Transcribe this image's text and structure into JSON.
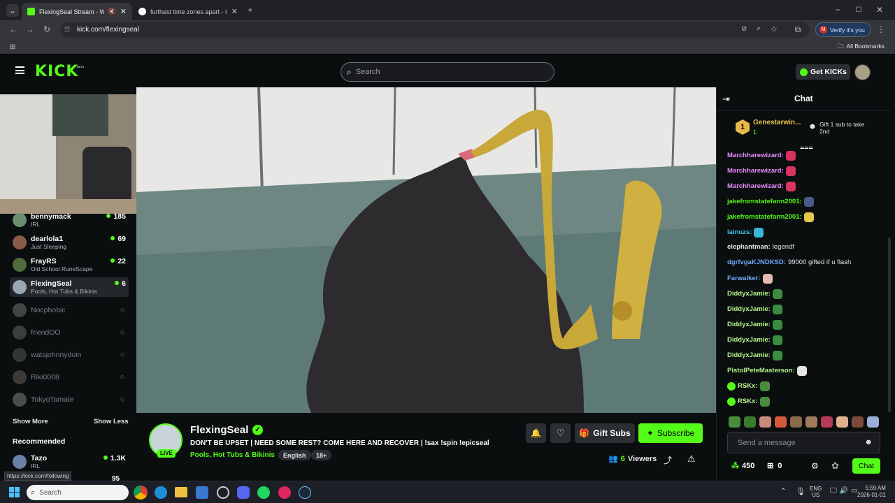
{
  "browser": {
    "tabs": [
      {
        "title": "FlexingSeal Stream - Watch",
        "active": true
      },
      {
        "title": "furthest time zones apart - Goo",
        "active": false
      }
    ],
    "url": "kick.com/flexingseal",
    "profile_label": "Verify it's you",
    "profile_initial": "M",
    "all_bookmarks": "All Bookmarks",
    "status_url": "https://kick.com/following"
  },
  "kick": {
    "logo": "KICK",
    "logo_beta": "BETA",
    "search_placeholder": "Search",
    "get_kicks": "Get KICKs"
  },
  "sidebar": {
    "channels": [
      {
        "name": "bennymack",
        "category": "IRL",
        "viewers": "185",
        "color": "#6b8f71"
      },
      {
        "name": "dearlola1",
        "category": "Just Sleeping",
        "viewers": "69",
        "color": "#8a5a4a"
      },
      {
        "name": "FrayRS",
        "category": "Old School RuneScape",
        "viewers": "22",
        "color": "#4e6b3a"
      },
      {
        "name": "FlexingSeal",
        "category": "Pools, Hot Tubs & Bikinis",
        "viewers": "6",
        "color": "#9aa7b3"
      }
    ],
    "offline": [
      "Nocphobic",
      "friendOO",
      "watsjohnnydoin",
      "Riki0008",
      "TokyoTamale"
    ],
    "show_more": "Show More",
    "show_less": "Show Less",
    "recommended_title": "Recommended",
    "recommended": [
      {
        "name": "Tazo",
        "category": "IRL",
        "viewers": "1.3K",
        "color": "#6a7fa8"
      },
      {
        "name": "",
        "category": "",
        "viewers": "95",
        "color": "#555"
      }
    ]
  },
  "stream": {
    "streamer": "FlexingSeal",
    "live_badge": "LIVE",
    "title": "DON'T BE UPSET | NEED SOME REST? COME HERE AND RECOVER | !sax !spin !epicseal",
    "category": "Pools, Hot Tubs & Bikinis",
    "tags": [
      "English",
      "18+"
    ],
    "viewers_count": "6",
    "viewers_label": "Viewers",
    "gift_subs": "Gift Subs",
    "subscribe": "Subscribe"
  },
  "chat": {
    "title": "Chat",
    "pinned_rank": "1",
    "pinned_user": "Genestarwin...",
    "pinned_count": "1",
    "gift_text": "Gift 1 sub to take 2nd",
    "messages": [
      {
        "user": "Marchharewizard:",
        "text": "",
        "color": "#e58cff",
        "emote": "#d8345f"
      },
      {
        "user": "Marchharewizard:",
        "text": "",
        "color": "#e58cff",
        "emote": "#d8345f"
      },
      {
        "user": "Marchharewizard:",
        "text": "",
        "color": "#e58cff",
        "emote": "#d8345f"
      },
      {
        "user": "jakefromstatefarm2001:",
        "text": "",
        "color": "#53fc18",
        "emote": "#4a5a8a"
      },
      {
        "user": "jakefromstatefarm2001:",
        "text": "",
        "color": "#53fc18",
        "emote": "#e5c84b"
      },
      {
        "user": "lainuzs:",
        "text": "",
        "color": "#37c7e8",
        "emote": "#3bb6d8"
      },
      {
        "user": "elephantman:",
        "text": "legendf",
        "color": "#e6e6e6",
        "emote": ""
      },
      {
        "user": "dgrfvgaKJNDKSD:",
        "text": "99000 gifted if u flash",
        "color": "#6fa8ff",
        "emote": ""
      },
      {
        "user": "Farwalker:",
        "text": "",
        "color": "#6fa8ff",
        "emote": "#e7b9b5"
      },
      {
        "user": "DiddyxJamie:",
        "text": "",
        "color": "#b6f58a",
        "emote": "#3a8c3e"
      },
      {
        "user": "DiddyxJamie:",
        "text": "",
        "color": "#b6f58a",
        "emote": "#3a8c3e"
      },
      {
        "user": "DiddyxJamie:",
        "text": "",
        "color": "#b6f58a",
        "emote": "#3a8c3e"
      },
      {
        "user": "DiddyxJamie:",
        "text": "",
        "color": "#b6f58a",
        "emote": "#3a8c3e"
      },
      {
        "user": "DiddyxJamie:",
        "text": "",
        "color": "#b6f58a",
        "emote": "#3a8c3e"
      },
      {
        "user": "PistolPeteMasterson:",
        "text": "",
        "color": "#b6f58a",
        "emote": "#e6e6e6"
      },
      {
        "user": "RSKx:",
        "text": "",
        "color": "#b6f58a",
        "emote": "#4a8c3e"
      },
      {
        "user": "RSKx:",
        "text": "",
        "color": "#b6f58a",
        "emote": "#4a8c3e"
      }
    ],
    "emote_bar_colors": [
      "#4a8c3e",
      "#3a7c2e",
      "#c98a7a",
      "#d35a3a",
      "#8a6a4a",
      "#a07a5a",
      "#b53a5a",
      "#e0b090",
      "#7a4a3a",
      "#9ab0d8"
    ],
    "input_placeholder": "Send a message",
    "points": "450",
    "gifts": "0",
    "send_button": "Chat"
  },
  "taskbar": {
    "search_placeholder": "Search",
    "lang_top": "ENG",
    "lang_bottom": "US",
    "time": "5:59 AM",
    "date": "2026-01-01"
  },
  "colors": {
    "accent": "#53fc18",
    "bg": "#0b0e0f"
  }
}
